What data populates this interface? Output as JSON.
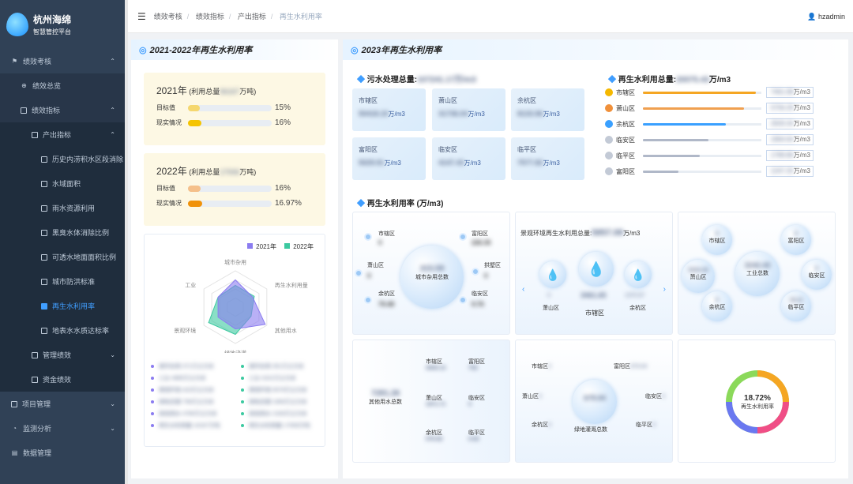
{
  "app": {
    "title": "杭州海绵",
    "subtitle": "智慧管控平台"
  },
  "menu": {
    "performance": "绩效考核",
    "overview": "绩效总览",
    "indicators": "绩效指标",
    "output": "产出指标",
    "items": [
      "历史内涝积水区段消除",
      "水域面积",
      "雨水资源利用",
      "黑臭水体消除比例",
      "可透水地面面积比例",
      "城市防洪标准",
      "再生水利用率",
      "地表水水质达标率"
    ],
    "mgmt": "管理绩效",
    "fund": "资金绩效",
    "project": "项目管理",
    "monitor": "监测分析",
    "data": "数据管理"
  },
  "breadcrumb": [
    "绩效考核",
    "绩效指标",
    "产出指标",
    "再生水利用率"
  ],
  "user": "hzadmin",
  "left": {
    "title": "2021-2022年再生水利用率",
    "y2021": {
      "year": "2021年",
      "total_pre": "(利用总量",
      "total_val": "56167",
      "total_suf": "万吨)",
      "target_label": "目标值",
      "target_pct": "15%",
      "actual_label": "现实情况",
      "actual_pct": "16%",
      "target_fill": 0.15,
      "actual_fill": 0.16
    },
    "y2022": {
      "year": "2022年",
      "total_pre": "(利用总量",
      "total_val": "17006",
      "total_suf": "万吨)",
      "target_label": "目标值",
      "target_pct": "16%",
      "actual_label": "现实情况",
      "actual_pct": "16.97%",
      "target_fill": 0.16,
      "actual_fill": 0.1697
    },
    "radar": {
      "legend": [
        "2021年",
        "2022年"
      ],
      "axes": [
        "城市杂用",
        "再生水利用量",
        "其他用水",
        "绿地浇灌",
        "景观环境",
        "工业"
      ],
      "s2021": [
        0.75,
        0.55,
        0.95,
        0.6,
        0.55,
        0.55
      ],
      "s2022": [
        0.6,
        0.6,
        0.5,
        0.75,
        0.85,
        0.55
      ],
      "c2021": "#8b7cf0",
      "c2022": "#3cc9a0"
    },
    "legend_rows": [
      "城市杂用 371万立方米",
      "工业 4985万立方米",
      "景观环境 423万立方米",
      "绿地浇灌 758万立方米",
      "其他用水 4780万立方米",
      "再生水利用量 10167万吨"
    ],
    "legend_rows2": [
      "城市杂用 351万立方米",
      "工业 3101万立方米",
      "景观环境 5579万立方米",
      "绿地浇灌 1083万立方米",
      "其他用水 2183万立方米",
      "再生水利用量 17006万吨"
    ]
  },
  "right": {
    "title": "2023年再生水利用率",
    "sewage_label": "污水处理总量:",
    "sewage_val": "107241.17万/m3",
    "sewage_cards": [
      {
        "name": "市辖区",
        "val": "50418.15",
        "unit": "万/m3"
      },
      {
        "name": "萧山区",
        "val": "31736.04",
        "unit": "万/m3"
      },
      {
        "name": "余杭区",
        "val": "8133.96",
        "unit": "万/m3"
      },
      {
        "name": "富阳区",
        "val": "5029.91",
        "unit": "万/m3"
      },
      {
        "name": "临安区",
        "val": "4147.43",
        "unit": "万/m3"
      },
      {
        "name": "临平区",
        "val": "7577.82",
        "unit": "万/m3"
      }
    ],
    "reuse_label": "再生水利用总量:",
    "reuse_val": "20075.43",
    "reuse_unit": "万/m3",
    "rank": [
      {
        "name": "市辖区",
        "fill": 0.95,
        "color": "#f5a623",
        "val": "7461.98"
      },
      {
        "name": "萧山区",
        "fill": 0.85,
        "color": "#f0a050",
        "val": "5756.29"
      },
      {
        "name": "余杭区",
        "fill": 0.7,
        "color": "#3aa0ff",
        "val": "2929.34"
      },
      {
        "name": "临安区",
        "fill": 0.55,
        "color": "#b0b8c8",
        "val": "1964.64"
      },
      {
        "name": "临平区",
        "fill": 0.48,
        "color": "#b0b8c8",
        "val": "1789.86"
      },
      {
        "name": "富阳区",
        "fill": 0.3,
        "color": "#b0b8c8",
        "val": "1247.25"
      }
    ],
    "rate_title": "再生水利用率 (万/m3)",
    "c1": {
      "center_val": "315.59",
      "center_label": "城市杂用总数",
      "items": [
        [
          "市辖区",
          "0"
        ],
        [
          "富阳区",
          "226.35"
        ],
        [
          "萧山区",
          "0"
        ],
        [
          "拱墅区",
          "0"
        ],
        [
          "余杭区",
          "79.48"
        ],
        [
          "临安区",
          "9.76"
        ]
      ]
    },
    "c2": {
      "title": "景观环境再生水利用总量:",
      "val": "5857.08",
      "unit": "万/m3",
      "items": [
        [
          "萧山区",
          "0"
        ],
        [
          "市辖区",
          "3461.65"
        ],
        [
          "余杭区",
          "1370.97"
        ]
      ]
    },
    "c3": {
      "center_val": "3242.43",
      "center_label": "工业总数",
      "items": [
        [
          "市辖区",
          "0"
        ],
        [
          "富阳区",
          "0"
        ],
        [
          "萧山区",
          "3224.32"
        ],
        [
          "临安区",
          "0"
        ],
        [
          "余杭区",
          "0"
        ],
        [
          "临平区",
          "18.11"
        ]
      ]
    },
    "c4": {
      "center_val": "7281.26",
      "center_label": "其他用水总数",
      "items": [
        [
          "市辖区",
          "3940.13"
        ],
        [
          "富阳区",
          "752"
        ],
        [
          "萧山区",
          "1971.71"
        ],
        [
          "临安区",
          "0"
        ],
        [
          "余杭区",
          "576.82"
        ],
        [
          "临平区",
          "0.62"
        ]
      ]
    },
    "c5": {
      "center_val": "679.04",
      "center_label": "绿地灌溉总数",
      "items": [
        [
          "市辖区",
          "0"
        ],
        [
          "富阳区",
          "679.04"
        ],
        [
          "萧山区",
          "0"
        ],
        [
          "临安区",
          "0"
        ],
        [
          "余杭区",
          "0"
        ],
        [
          "临平区",
          "0"
        ]
      ]
    },
    "c6": {
      "pct": "18.72%",
      "label": "再生水利用率"
    }
  }
}
